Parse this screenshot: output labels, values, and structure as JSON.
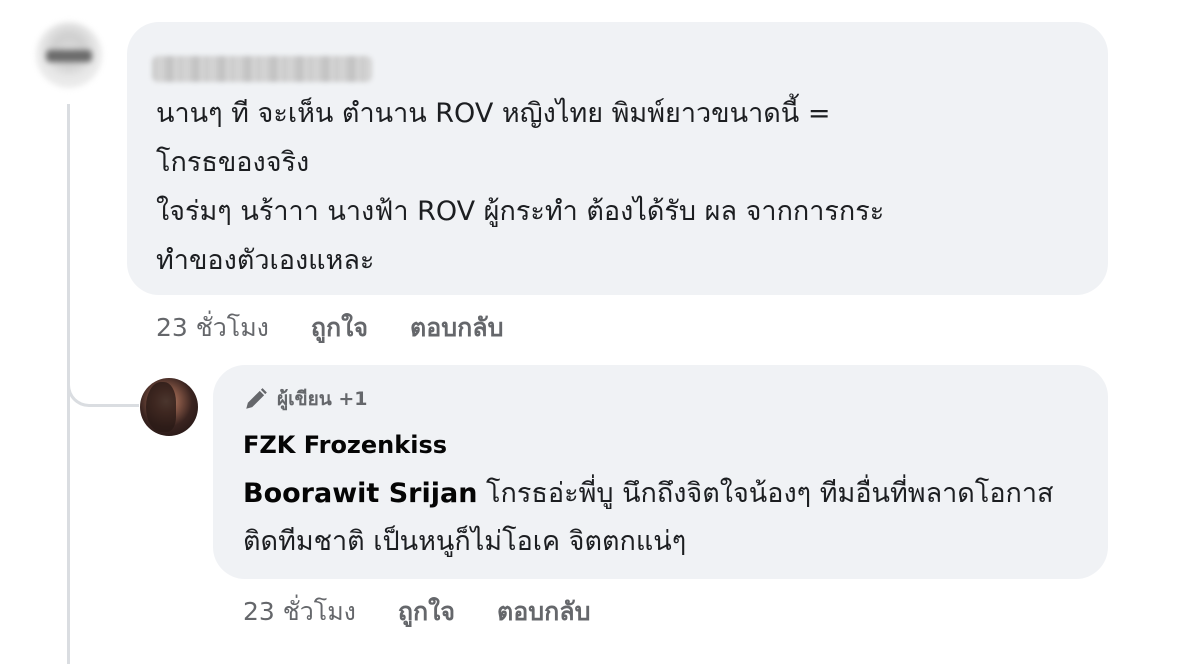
{
  "comment": {
    "text": "นานๆ ที จะเห็น ตำนาน ROV หญิงไทย พิมพ์ยาวขนาดนี้ =\nโกรธของจริง\nใจร่มๆ นร้าาา นางฟ้า ROV ผู้กระทำ ต้องได้รับ ผล จากการกระ\nทำของตัวเองแหละ",
    "time": "23 ชั่วโมง",
    "like_label": "ถูกใจ",
    "reply_label": "ตอบกลับ"
  },
  "reply": {
    "badge": "ผู้เขียน +1",
    "author": "FZK Frozenkiss",
    "mention": "Boorawit Srijan",
    "text": " โกรธอ่ะพี่บู นึกถึงจิตใจน้องๆ ทีมอื่นที่พลาดโอกาสติดทีมชาติ เป็นหนูก็ไม่โอเค จิตตกแน่ๆ",
    "time": "23 ชั่วโมง",
    "like_label": "ถูกใจ",
    "reply_label": "ตอบกลับ"
  },
  "icons": {
    "badge_icon": "pencil-icon"
  },
  "colors": {
    "bubble": "#f0f2f5",
    "meta_text": "#65676b",
    "thread_line": "#dadde1"
  }
}
